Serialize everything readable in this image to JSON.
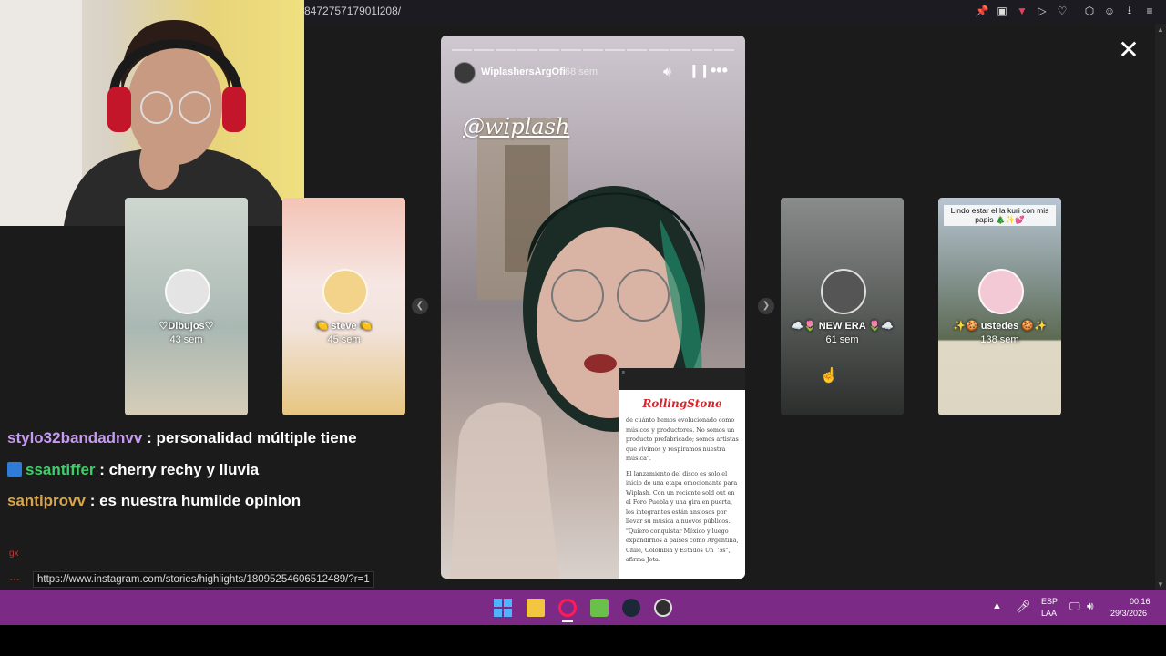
{
  "browser": {
    "url_fragment": "847275717901l208/",
    "toolbar_icons": [
      "pin-icon",
      "screenshot-icon",
      "pocket-icon",
      "play-icon",
      "heart-icon",
      "extension-icon",
      "account-icon",
      "download-icon",
      "menu-icon"
    ]
  },
  "stream_chat": {
    "messages": [
      {
        "user": "stylo32bandadnvv",
        "text": ": personalidad múltiple tiene",
        "color": "#c79bf2"
      },
      {
        "user": "ssantiffer",
        "text": ": cherry rechy y lluvia",
        "color": "#3ecf6a"
      },
      {
        "user": "santiprovv",
        "text": ": es nuestra humilde opinion",
        "color": "#d8a54f"
      }
    ],
    "side_labels": [
      "gx",
      "…"
    ]
  },
  "highlights_left": [
    {
      "title": "♡Dibujos♡",
      "age": "43 sem"
    },
    {
      "title": "🍋 steve 🍋",
      "age": "45 sem"
    }
  ],
  "story": {
    "username": "WiplashersArgOfi",
    "time": "68 sem",
    "mention": "@wiplash",
    "article": {
      "brand": "RollingStone",
      "paragraph1": "de cuánto hemos evolucionado como músicos y productores. No somos un producto prefabricado; somos artistas que vivimos y respiramos nuestra música\".",
      "paragraph2": "El lanzamiento del disco es solo el inicio de una etapa emocionante para Wiplash. Con un reciente sold out en el Foro Puebla y una gira en puerta, los integrantes están ansiosos por llevar su música a nuevos públicos. \"Quiero conquistar México y luego expandirnos a países como Argentina, Chile, Colombia y Estados Unidos\", afirma Jota."
    },
    "segments": 13
  },
  "highlights_right": [
    {
      "title": "☁️🌷 NEW ERA 🌷☁️",
      "age": "61 sem"
    },
    {
      "title": "✨🍪 ustedes 🍪✨",
      "age": "138 sem",
      "caption": "Lindo estar el la kuri con mis papis 🎄✨💕"
    }
  ],
  "status_url": "https://www.instagram.com/stories/highlights/18095254606512489/?r=1",
  "taskbar": {
    "lang": "ESP",
    "layout": "LAA",
    "time": "00:16",
    "date": "29/3/2026",
    "apps": [
      "windows-start-icon",
      "file-explorer-icon",
      "opera-gx-icon",
      "android-icon",
      "steam-icon",
      "obs-icon"
    ]
  }
}
